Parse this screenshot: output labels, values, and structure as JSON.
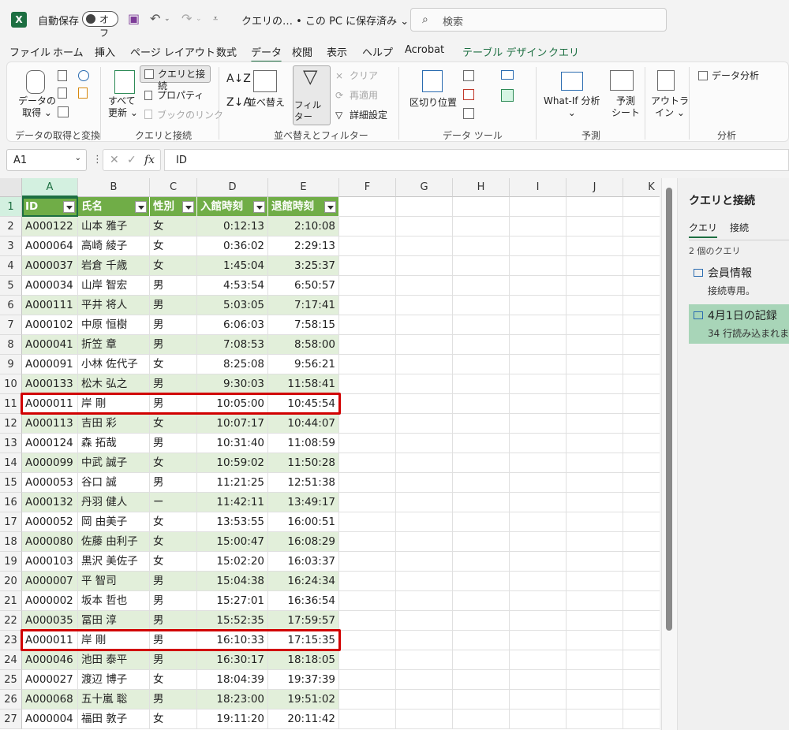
{
  "titlebar": {
    "autosave_label": "自動保存",
    "autosave_state": "オフ",
    "doc_title": "クエリの… • この PC に保存済み ⌄",
    "search_placeholder": "検索"
  },
  "tabs": [
    "ファイル",
    "ホーム",
    "挿入",
    "ページ レイアウト",
    "数式",
    "データ",
    "校閲",
    "表示",
    "ヘルプ",
    "Acrobat",
    "テーブル デザイン",
    "クエリ"
  ],
  "active_tab": "データ",
  "ribbon": {
    "get_data": "データの\n取得 ⌄",
    "refresh_all": "すべて\n更新 ⌄",
    "queries_connections": "クエリと接続",
    "properties": "プロパティ",
    "book_links": "ブックのリンク",
    "sort": "並べ替え",
    "filter": "フィルター",
    "clear": "クリア",
    "reapply": "再適用",
    "advanced": "詳細設定",
    "text_to_columns": "区切り位置",
    "whatif": "What-If 分析\n⌄",
    "forecast_sheet": "予測\nシート",
    "outline": "アウトラ\nイン ⌄",
    "data_analysis": "データ分析",
    "groups": {
      "get_transform": "データの取得と変換",
      "queries": "クエリと接続",
      "sort_filter": "並べ替えとフィルター",
      "data_tools": "データ ツール",
      "forecast": "予測",
      "analysis": "分析"
    }
  },
  "formula_bar": {
    "name_box": "A1",
    "content": "ID",
    "fx": "fx"
  },
  "columns": [
    "A",
    "B",
    "C",
    "D",
    "E",
    "F",
    "G",
    "H",
    "I",
    "J",
    "K"
  ],
  "table": {
    "headers": [
      "ID",
      "氏名",
      "性別",
      "入館時刻",
      "退館時刻"
    ],
    "rows": [
      [
        "A000122",
        "山本 雅子",
        "女",
        "0:12:13",
        "2:10:08"
      ],
      [
        "A000064",
        "高崎 綾子",
        "女",
        "0:36:02",
        "2:29:13"
      ],
      [
        "A000037",
        "岩倉 千歳",
        "女",
        "1:45:04",
        "3:25:37"
      ],
      [
        "A000034",
        "山岸 智宏",
        "男",
        "4:53:54",
        "6:50:57"
      ],
      [
        "A000111",
        "平井 将人",
        "男",
        "5:03:05",
        "7:17:41"
      ],
      [
        "A000102",
        "中原 恒樹",
        "男",
        "6:06:03",
        "7:58:15"
      ],
      [
        "A000041",
        "折笠 章",
        "男",
        "7:08:53",
        "8:58:00"
      ],
      [
        "A000091",
        "小林 佐代子",
        "女",
        "8:25:08",
        "9:56:21"
      ],
      [
        "A000133",
        "松木 弘之",
        "男",
        "9:30:03",
        "11:58:41"
      ],
      [
        "A000011",
        "岸 剛",
        "男",
        "10:05:00",
        "10:45:54"
      ],
      [
        "A000113",
        "吉田 彩",
        "女",
        "10:07:17",
        "10:44:07"
      ],
      [
        "A000124",
        "森 拓哉",
        "男",
        "10:31:40",
        "11:08:59"
      ],
      [
        "A000099",
        "中武 誠子",
        "女",
        "10:59:02",
        "11:50:28"
      ],
      [
        "A000053",
        "谷口 誠",
        "男",
        "11:21:25",
        "12:51:38"
      ],
      [
        "A000132",
        "丹羽 健人",
        "ー",
        "11:42:11",
        "13:49:17"
      ],
      [
        "A000052",
        "岡 由美子",
        "女",
        "13:53:55",
        "16:00:51"
      ],
      [
        "A000080",
        "佐藤 由利子",
        "女",
        "15:00:47",
        "16:08:29"
      ],
      [
        "A000103",
        "黒沢 美佐子",
        "女",
        "15:02:20",
        "16:03:37"
      ],
      [
        "A000007",
        "平 智司",
        "男",
        "15:04:38",
        "16:24:34"
      ],
      [
        "A000002",
        "坂本 哲也",
        "男",
        "15:27:01",
        "16:36:54"
      ],
      [
        "A000035",
        "冨田 淳",
        "男",
        "15:52:35",
        "17:59:57"
      ],
      [
        "A000011",
        "岸 剛",
        "男",
        "16:10:33",
        "17:15:35"
      ],
      [
        "A000046",
        "池田 泰平",
        "男",
        "16:30:17",
        "18:18:05"
      ],
      [
        "A000027",
        "渡辺 博子",
        "女",
        "18:04:39",
        "19:37:39"
      ],
      [
        "A000068",
        "五十嵐 聡",
        "男",
        "18:23:00",
        "19:51:02"
      ],
      [
        "A000004",
        "福田 敦子",
        "女",
        "19:11:20",
        "20:11:42"
      ]
    ]
  },
  "highlighted_rows": [
    11,
    23
  ],
  "query_pane": {
    "title": "クエリと接続",
    "tab_queries": "クエリ",
    "tab_connections": "接続",
    "count": "2 個のクエリ",
    "items": [
      {
        "name": "会員情報",
        "status": "接続専用。"
      },
      {
        "name": "4月1日の記録",
        "status": "34 行読み込まれま"
      }
    ]
  },
  "colors": {
    "excel_green": "#1d6f42",
    "table_header": "#70ad47",
    "band": "#e2efda",
    "highlight": "#d10000"
  }
}
